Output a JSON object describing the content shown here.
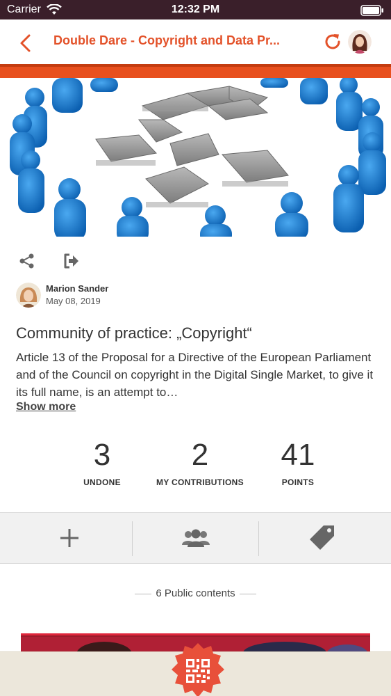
{
  "status_bar": {
    "carrier": "Carrier",
    "time": "12:32 PM"
  },
  "nav": {
    "title": "Double Dare - Copyright and Data Pr...",
    "accent_color": "#e8501e"
  },
  "author": {
    "name": "Marion Sander",
    "date": "May 08, 2019"
  },
  "article": {
    "title": "Community of practice: „Copyright“",
    "description": "Article 13 of the Proposal for a Directive of the European Parliament and of the Council on copyright in the Digital Single Market, to give it its full name, is an attempt to…",
    "show_more": "Show more"
  },
  "stats": [
    {
      "value": "3",
      "label": "UNDONE"
    },
    {
      "value": "2",
      "label": "MY CONTRIBUTIONS"
    },
    {
      "value": "41",
      "label": "POINTS"
    }
  ],
  "toolbar": {
    "icons": [
      "plus-icon",
      "group-icon",
      "tag-icon"
    ]
  },
  "public_contents": "6 Public contents"
}
